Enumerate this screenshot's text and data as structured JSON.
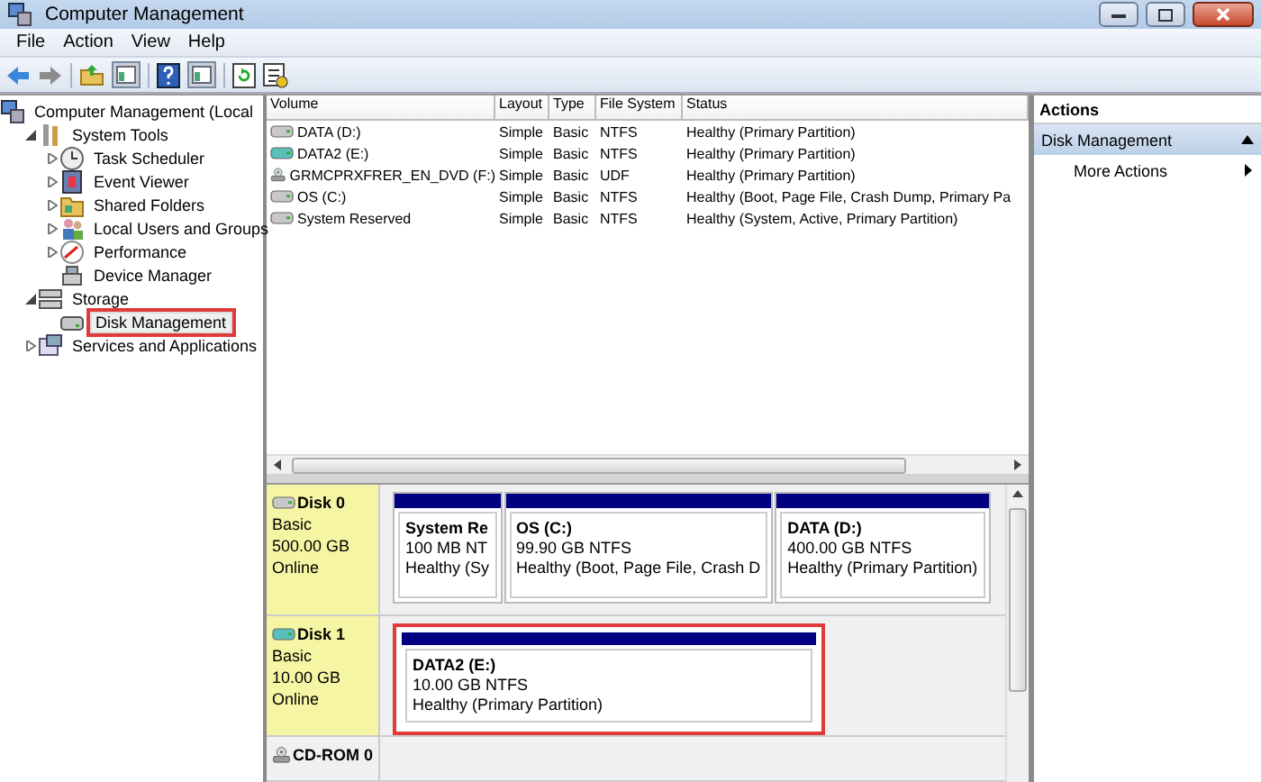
{
  "window": {
    "title": "Computer Management"
  },
  "menu": [
    "File",
    "Action",
    "View",
    "Help"
  ],
  "toolbar": [
    {
      "kind": "back"
    },
    {
      "kind": "forward"
    },
    {
      "kind": "sep"
    },
    {
      "kind": "up"
    },
    {
      "kind": "pane"
    },
    {
      "kind": "sep"
    },
    {
      "kind": "help"
    },
    {
      "kind": "pane"
    },
    {
      "kind": "sep"
    },
    {
      "kind": "refresh"
    },
    {
      "kind": "export"
    }
  ],
  "tree": [
    {
      "label": "Computer Management (Local",
      "kind": "computer",
      "selected": false,
      "highlighted": false,
      "children": [
        {
          "label": "System Tools",
          "kind": "tools",
          "expanded": true,
          "selected": false,
          "highlighted": false,
          "children": [
            {
              "label": "Task Scheduler",
              "kind": "clock",
              "expanded": false,
              "selected": false,
              "highlighted": false
            },
            {
              "label": "Event Viewer",
              "kind": "log",
              "expanded": false,
              "selected": false,
              "highlighted": false
            },
            {
              "label": "Shared Folders",
              "kind": "folder",
              "expanded": false,
              "selected": false,
              "highlighted": false
            },
            {
              "label": "Local Users and Groups",
              "kind": "users",
              "expanded": false,
              "selected": false,
              "highlighted": false
            },
            {
              "label": "Performance",
              "kind": "gauge",
              "expanded": false,
              "selected": false,
              "highlighted": false
            },
            {
              "label": "Device Manager",
              "kind": "device",
              "selected": false,
              "highlighted": false
            }
          ]
        },
        {
          "label": "Storage",
          "kind": "storage",
          "expanded": true,
          "selected": false,
          "highlighted": false,
          "children": [
            {
              "label": "Disk Management",
              "kind": "disk",
              "selected": true,
              "highlighted": true
            }
          ]
        },
        {
          "label": "Services and Applications",
          "kind": "services",
          "expanded": false,
          "selected": false,
          "highlighted": false
        }
      ]
    }
  ],
  "volumes": {
    "columns": [
      "Volume",
      "Layout",
      "Type",
      "File System",
      "Status"
    ],
    "rows": [
      {
        "kind": "hdd",
        "cells": [
          "DATA (D:)",
          "Simple",
          "Basic",
          "NTFS",
          "Healthy (Primary Partition)"
        ]
      },
      {
        "kind": "vhd",
        "cells": [
          "DATA2 (E:)",
          "Simple",
          "Basic",
          "NTFS",
          "Healthy (Primary Partition)"
        ]
      },
      {
        "kind": "cdrom",
        "cells": [
          "GRMCPRXFRER_EN_DVD (F:)",
          "Simple",
          "Basic",
          "UDF",
          "Healthy (Primary Partition)"
        ]
      },
      {
        "kind": "hdd",
        "cells": [
          "OS (C:)",
          "Simple",
          "Basic",
          "NTFS",
          "Healthy (Boot, Page File, Crash Dump, Primary Pa"
        ]
      },
      {
        "kind": "hdd",
        "cells": [
          "System Reserved",
          "Simple",
          "Basic",
          "NTFS",
          "Healthy (System, Active, Primary Partition)"
        ]
      }
    ]
  },
  "disks": [
    {
      "name": "Disk 0",
      "kind": "hdd",
      "type": "Basic",
      "size": "500.00 GB",
      "status": "Online",
      "highlighted": true,
      "partitions": [
        {
          "name": "System Re",
          "detail": "100 MB NT",
          "status": "Healthy (Sy",
          "highlighted": false
        },
        {
          "name": "OS  (C:)",
          "detail": "99.90 GB NTFS",
          "status": "Healthy (Boot, Page File, Crash D",
          "highlighted": false
        },
        {
          "name": "DATA  (D:)",
          "detail": "400.00 GB NTFS",
          "status": "Healthy (Primary Partition)",
          "highlighted": false
        }
      ]
    },
    {
      "name": "Disk 1",
      "kind": "vhd",
      "type": "Basic",
      "size": "10.00 GB",
      "status": "Online",
      "highlighted": true,
      "partitions": [
        {
          "name": "DATA2  (E:)",
          "detail": "10.00 GB NTFS",
          "status": "Healthy (Primary Partition)",
          "highlighted": true
        }
      ]
    },
    {
      "name": "CD-ROM 0",
      "kind": "cdrom",
      "highlighted": false
    }
  ],
  "actions": {
    "title": "Actions",
    "sections": [
      {
        "title": "Disk Management",
        "expanded": true,
        "items": [
          "More Actions"
        ]
      }
    ]
  }
}
